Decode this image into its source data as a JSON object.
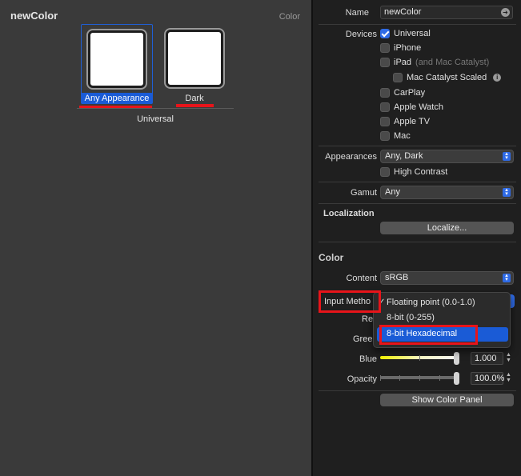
{
  "canvas": {
    "title": "newColor",
    "kind": "Color",
    "swatches": [
      {
        "label": "Any Appearance"
      },
      {
        "label": "Dark"
      }
    ],
    "group_label": "Universal"
  },
  "inspector": {
    "name_label": "Name",
    "name_value": "newColor",
    "devices_label": "Devices",
    "devices": [
      {
        "label": "Universal",
        "checked": true
      },
      {
        "label": "iPhone",
        "checked": false
      },
      {
        "label": "iPad",
        "note": "(and Mac Catalyst)",
        "checked": false
      },
      {
        "label": "Mac Catalyst Scaled",
        "checked": false
      },
      {
        "label": "CarPlay",
        "checked": false
      },
      {
        "label": "Apple Watch",
        "checked": false
      },
      {
        "label": "Apple TV",
        "checked": false
      },
      {
        "label": "Mac",
        "checked": false
      }
    ],
    "appearances_label": "Appearances",
    "appearances_value": "Any, Dark",
    "high_contrast_label": "High Contrast",
    "gamut_label": "Gamut",
    "gamut_value": "Any",
    "localization_title": "Localization",
    "localize_button": "Localize...",
    "color_title": "Color",
    "content_label": "Content",
    "content_value": "sRGB",
    "input_method_label": "Input Metho",
    "red_label": "Re",
    "green_label": "Gree",
    "blue_label": "Blue",
    "blue_value": "1.000",
    "opacity_label": "Opacity",
    "opacity_value": "100.0%",
    "show_color_panel_button": "Show Color Panel",
    "colors": {
      "accent": "#2f6be6",
      "highlight": "#1a5bd6",
      "annotation": "#e8141a"
    }
  },
  "input_method_menu": {
    "items": [
      {
        "label": "Floating point (0.0-1.0)",
        "checked": true
      },
      {
        "label": "8-bit (0-255)",
        "checked": false
      },
      {
        "label": "8-bit Hexadecimal",
        "checked": false,
        "highlighted": true
      }
    ]
  }
}
